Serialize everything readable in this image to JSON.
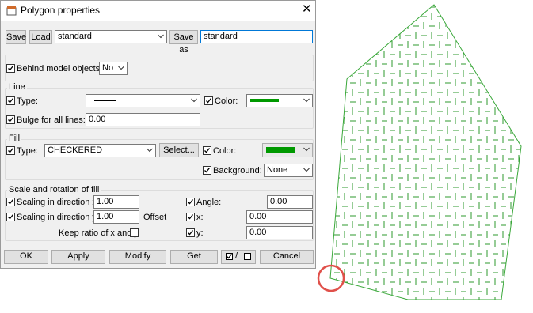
{
  "window": {
    "title": "Polygon properties"
  },
  "toolbar": {
    "save": "Save",
    "load": "Load",
    "preset": "standard",
    "save_as": "Save as",
    "save_as_value": "standard"
  },
  "behind": {
    "label": "Behind model objects",
    "value": "No"
  },
  "line": {
    "title": "Line",
    "type_label": "Type:",
    "color_label": "Color:",
    "bulge_label": "Bulge for all lines:",
    "bulge_value": "0.00",
    "color": "#009900"
  },
  "fill": {
    "title": "Fill",
    "type_label": "Type:",
    "type_value": "CHECKERED",
    "select_button": "Select...",
    "color_label": "Color:",
    "background_label": "Background:",
    "background_value": "None",
    "color": "#009900"
  },
  "scale": {
    "title": "Scale and rotation of fill",
    "x_label": "Scaling in direction x",
    "x_value": "1.00",
    "y_label": "Scaling in direction y",
    "y_value": "1.00",
    "offset_label": "Offset",
    "angle_label": "Angle:",
    "angle_value": "0.00",
    "ox_label": "x:",
    "ox_value": "0.00",
    "oy_label": "y:",
    "oy_value": "0.00",
    "keep_ratio_label": "Keep ratio of x and y"
  },
  "buttons": {
    "ok": "OK",
    "apply": "Apply",
    "modify": "Modify",
    "get": "Get",
    "toggle": "/",
    "cancel": "Cancel"
  },
  "polygon": {
    "stroke_color": "#3aa83a",
    "hatch_color": "#2e9a2e",
    "highlight_color": "#e0504a"
  }
}
